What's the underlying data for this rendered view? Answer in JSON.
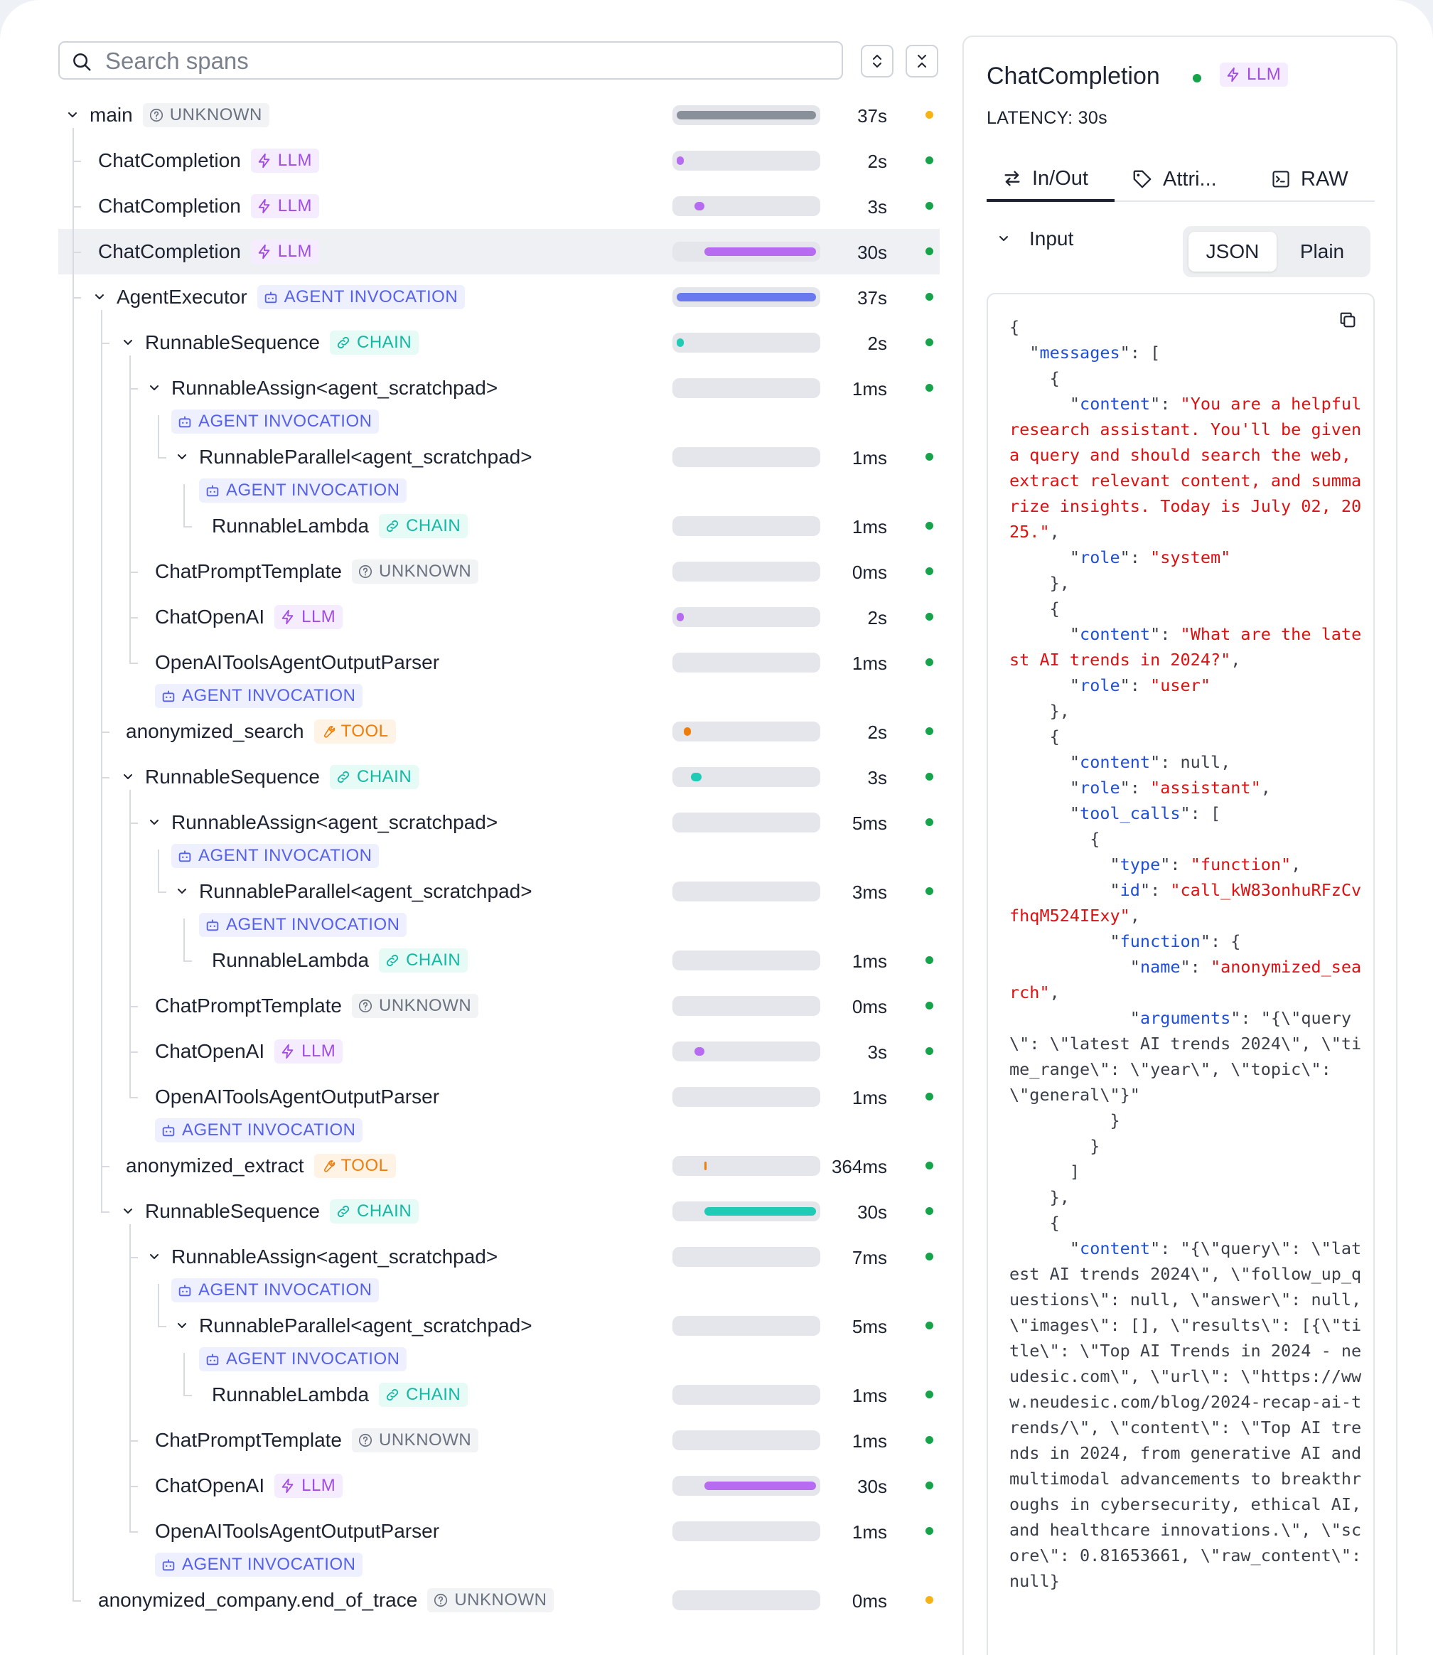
{
  "search": {
    "placeholder": "Search spans"
  },
  "colors": {
    "llm": "#a24de0",
    "agent": "#5561e8",
    "chain": "#14b8a3",
    "tool": "#f07d0a",
    "unknown": "#6b7280",
    "status_ok": "#16a34a",
    "status_unknown": "#f5b316",
    "bar_gray": "#8a909a",
    "bar_agent": "#6b79ee"
  },
  "icons": {
    "search": "search-icon",
    "expand": "expand-all-icon",
    "collapse": "collapse-all-icon",
    "llm": "bolt-icon",
    "agent": "robot-icon",
    "chain": "link-icon",
    "tool": "wrench-icon",
    "unknown": "question-circle-icon",
    "copy": "copy-icon"
  },
  "spans": [
    {
      "name": "main",
      "kind": "UNKNOWN",
      "duration": "37s",
      "status": "unknown",
      "level": 0,
      "expanded": true,
      "bar_start": 0.0,
      "bar_span": 1.0,
      "bar_color": "gray",
      "wrap": false
    },
    {
      "name": "ChatCompletion",
      "kind": "LLM",
      "duration": "2s",
      "status": "ok",
      "level": 1,
      "expanded": false,
      "bar_start": 0.0,
      "bar_span": 0.05,
      "bar_color": "llm",
      "wrap": false
    },
    {
      "name": "ChatCompletion",
      "kind": "LLM",
      "duration": "3s",
      "status": "ok",
      "level": 1,
      "expanded": false,
      "bar_start": 0.13,
      "bar_span": 0.07,
      "bar_color": "llm",
      "wrap": false
    },
    {
      "name": "ChatCompletion",
      "kind": "LLM",
      "duration": "30s",
      "status": "ok",
      "level": 1,
      "expanded": false,
      "bar_start": 0.2,
      "bar_span": 0.8,
      "bar_color": "llm",
      "wrap": false,
      "selected": true
    },
    {
      "name": "AgentExecutor",
      "kind": "AGENT INVOCATION",
      "duration": "37s",
      "status": "ok",
      "level": 1,
      "expanded": true,
      "bar_start": 0.0,
      "bar_span": 1.0,
      "bar_color": "agent",
      "wrap": false
    },
    {
      "name": "RunnableSequence",
      "kind": "CHAIN",
      "duration": "2s",
      "status": "ok",
      "level": 2,
      "expanded": true,
      "bar_start": 0.0,
      "bar_span": 0.05,
      "bar_color": "chain",
      "wrap": false
    },
    {
      "name": "RunnableAssign<agent_scratchpad>",
      "kind": "AGENT INVOCATION",
      "duration": "1ms",
      "status": "ok",
      "level": 3,
      "expanded": true,
      "bar_start": 0,
      "bar_span": 0,
      "bar_color": "none",
      "wrap": true
    },
    {
      "name": "RunnableParallel<agent_scratchpad>",
      "kind": "AGENT INVOCATION",
      "duration": "1ms",
      "status": "ok",
      "level": 4,
      "expanded": true,
      "bar_start": 0,
      "bar_span": 0,
      "bar_color": "none",
      "wrap": true
    },
    {
      "name": "RunnableLambda",
      "kind": "CHAIN",
      "duration": "1ms",
      "status": "ok",
      "level": 5,
      "expanded": false,
      "bar_start": 0,
      "bar_span": 0,
      "bar_color": "none",
      "wrap": false
    },
    {
      "name": "ChatPromptTemplate",
      "kind": "UNKNOWN",
      "duration": "0ms",
      "status": "ok",
      "level": 3,
      "expanded": false,
      "bar_start": 0,
      "bar_span": 0,
      "bar_color": "none",
      "wrap": false
    },
    {
      "name": "ChatOpenAI",
      "kind": "LLM",
      "duration": "2s",
      "status": "ok",
      "level": 3,
      "expanded": false,
      "bar_start": 0.0,
      "bar_span": 0.05,
      "bar_color": "llm",
      "wrap": false
    },
    {
      "name": "OpenAIToolsAgentOutputParser",
      "kind": "AGENT INVOCATION",
      "duration": "1ms",
      "status": "ok",
      "level": 3,
      "expanded": false,
      "bar_start": 0,
      "bar_span": 0,
      "bar_color": "none",
      "wrap": true
    },
    {
      "name": "anonymized_search",
      "kind": "TOOL",
      "duration": "2s",
      "status": "ok",
      "level": 2,
      "expanded": false,
      "bar_start": 0.05,
      "bar_span": 0.05,
      "bar_color": "tool",
      "wrap": false
    },
    {
      "name": "RunnableSequence",
      "kind": "CHAIN",
      "duration": "3s",
      "status": "ok",
      "level": 2,
      "expanded": true,
      "bar_start": 0.1,
      "bar_span": 0.08,
      "bar_color": "chain",
      "wrap": false
    },
    {
      "name": "RunnableAssign<agent_scratchpad>",
      "kind": "AGENT INVOCATION",
      "duration": "5ms",
      "status": "ok",
      "level": 3,
      "expanded": true,
      "bar_start": 0,
      "bar_span": 0,
      "bar_color": "none",
      "wrap": true
    },
    {
      "name": "RunnableParallel<agent_scratchpad>",
      "kind": "AGENT INVOCATION",
      "duration": "3ms",
      "status": "ok",
      "level": 4,
      "expanded": true,
      "bar_start": 0,
      "bar_span": 0,
      "bar_color": "none",
      "wrap": true
    },
    {
      "name": "RunnableLambda",
      "kind": "CHAIN",
      "duration": "1ms",
      "status": "ok",
      "level": 5,
      "expanded": false,
      "bar_start": 0,
      "bar_span": 0,
      "bar_color": "none",
      "wrap": false
    },
    {
      "name": "ChatPromptTemplate",
      "kind": "UNKNOWN",
      "duration": "0ms",
      "status": "ok",
      "level": 3,
      "expanded": false,
      "bar_start": 0,
      "bar_span": 0,
      "bar_color": "none",
      "wrap": false
    },
    {
      "name": "ChatOpenAI",
      "kind": "LLM",
      "duration": "3s",
      "status": "ok",
      "level": 3,
      "expanded": false,
      "bar_start": 0.13,
      "bar_span": 0.07,
      "bar_color": "llm",
      "wrap": false
    },
    {
      "name": "OpenAIToolsAgentOutputParser",
      "kind": "AGENT INVOCATION",
      "duration": "1ms",
      "status": "ok",
      "level": 3,
      "expanded": false,
      "bar_start": 0,
      "bar_span": 0,
      "bar_color": "none",
      "wrap": true
    },
    {
      "name": "anonymized_extract",
      "kind": "TOOL",
      "duration": "364ms",
      "status": "ok",
      "level": 2,
      "expanded": false,
      "bar_start": 0.2,
      "bar_span": 0.01,
      "bar_color": "tool",
      "wrap": false
    },
    {
      "name": "RunnableSequence",
      "kind": "CHAIN",
      "duration": "30s",
      "status": "ok",
      "level": 2,
      "expanded": true,
      "bar_start": 0.2,
      "bar_span": 0.8,
      "bar_color": "chain",
      "wrap": false
    },
    {
      "name": "RunnableAssign<agent_scratchpad>",
      "kind": "AGENT INVOCATION",
      "duration": "7ms",
      "status": "ok",
      "level": 3,
      "expanded": true,
      "bar_start": 0,
      "bar_span": 0,
      "bar_color": "none",
      "wrap": true
    },
    {
      "name": "RunnableParallel<agent_scratchpad>",
      "kind": "AGENT INVOCATION",
      "duration": "5ms",
      "status": "ok",
      "level": 4,
      "expanded": true,
      "bar_start": 0,
      "bar_span": 0,
      "bar_color": "none",
      "wrap": true
    },
    {
      "name": "RunnableLambda",
      "kind": "CHAIN",
      "duration": "1ms",
      "status": "ok",
      "level": 5,
      "expanded": false,
      "bar_start": 0,
      "bar_span": 0,
      "bar_color": "none",
      "wrap": false
    },
    {
      "name": "ChatPromptTemplate",
      "kind": "UNKNOWN",
      "duration": "1ms",
      "status": "ok",
      "level": 3,
      "expanded": false,
      "bar_start": 0,
      "bar_span": 0,
      "bar_color": "none",
      "wrap": false
    },
    {
      "name": "ChatOpenAI",
      "kind": "LLM",
      "duration": "30s",
      "status": "ok",
      "level": 3,
      "expanded": false,
      "bar_start": 0.2,
      "bar_span": 0.8,
      "bar_color": "llm",
      "wrap": false
    },
    {
      "name": "OpenAIToolsAgentOutputParser",
      "kind": "AGENT INVOCATION",
      "duration": "1ms",
      "status": "ok",
      "level": 3,
      "expanded": false,
      "bar_start": 0,
      "bar_span": 0,
      "bar_color": "none",
      "wrap": true
    },
    {
      "name": "anonymized_company.end_of_trace",
      "kind": "UNKNOWN",
      "duration": "0ms",
      "status": "unknown",
      "level": 1,
      "expanded": false,
      "bar_start": 0,
      "bar_span": 0,
      "bar_color": "none",
      "wrap": false
    }
  ],
  "panel": {
    "title": "ChatCompletion",
    "kind": "LLM",
    "latency": "LATENCY: 30s",
    "tabs": [
      {
        "label": "In/Out",
        "icon": "arrows-swap-icon",
        "active": true
      },
      {
        "label": "Attri...",
        "icon": "tag-icon",
        "active": false
      },
      {
        "label": "RAW",
        "icon": "terminal-icon",
        "active": false
      }
    ],
    "input_label": "Input",
    "format_options": [
      "JSON",
      "Plain"
    ],
    "format_selected": "JSON",
    "json_lines": [
      "{",
      "  \"messages\": [",
      "    {",
      "      \"content\": \"You are a helpful research assistant. You'll be given a query and should search the web, extract relevant content, and summarize insights. Today is July 02, 2025.\",",
      "      \"role\": \"system\"",
      "    },",
      "    {",
      "      \"content\": \"What are the latest AI trends in 2024?\",",
      "      \"role\": \"user\"",
      "    },",
      "    {",
      "      \"content\": null,",
      "      \"role\": \"assistant\",",
      "      \"tool_calls\": [",
      "        {",
      "          \"type\": \"function\",",
      "          \"id\": \"call_kW83onhuRFzCvfhqM524IExy\",",
      "          \"function\": {",
      "            \"name\": \"anonymized_search\",",
      "            \"arguments\": \"{\\\"query\\\": \\\"latest AI trends 2024\\\", \\\"time_range\\\": \\\"year\\\", \\\"topic\\\": \\\"general\\\"}\"",
      "          }",
      "        }",
      "      ]",
      "    },",
      "    {",
      "      \"content\": \"{\\\"query\\\": \\\"latest AI trends 2024\\\", \\\"follow_up_questions\\\": null, \\\"answer\\\": null, \\\"images\\\": [], \\\"results\\\": [{\\\"title\\\": \\\"Top AI Trends in 2024 - neudesic.com\\\", \\\"url\\\": \\\"https://www.neudesic.com/blog/2024-recap-ai-trends/\\\", \\\"content\\\": \\\"Top AI trends in 2024, from generative AI and multimodal advancements to breakthroughs in cybersecurity, ethical AI, and healthcare innovations.\\\", \\\"score\\\": 0.81653661, \\\"raw_content\\\": null}"
    ]
  }
}
